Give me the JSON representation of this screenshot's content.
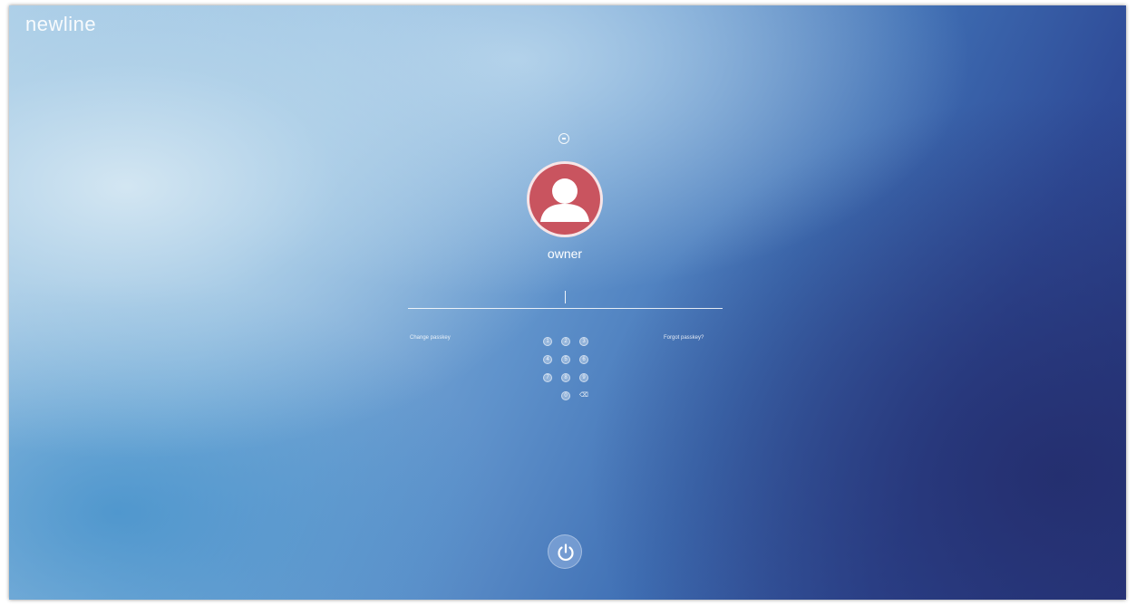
{
  "brand": {
    "name": "newline"
  },
  "user": {
    "name": "owner",
    "avatar_color": "#c9545f"
  },
  "icons": {
    "switch_user": "switch-user-icon",
    "avatar": "person-icon",
    "power": "power-icon",
    "backspace": "backspace-icon"
  },
  "password": {
    "value": "",
    "placeholder": ""
  },
  "links": {
    "change_password": "Change passkey",
    "forgot_password": "Forgot passkey?"
  },
  "keypad": {
    "keys": [
      "1",
      "2",
      "3",
      "4",
      "5",
      "6",
      "7",
      "8",
      "9",
      "0"
    ],
    "backspace_label": "⌫"
  }
}
